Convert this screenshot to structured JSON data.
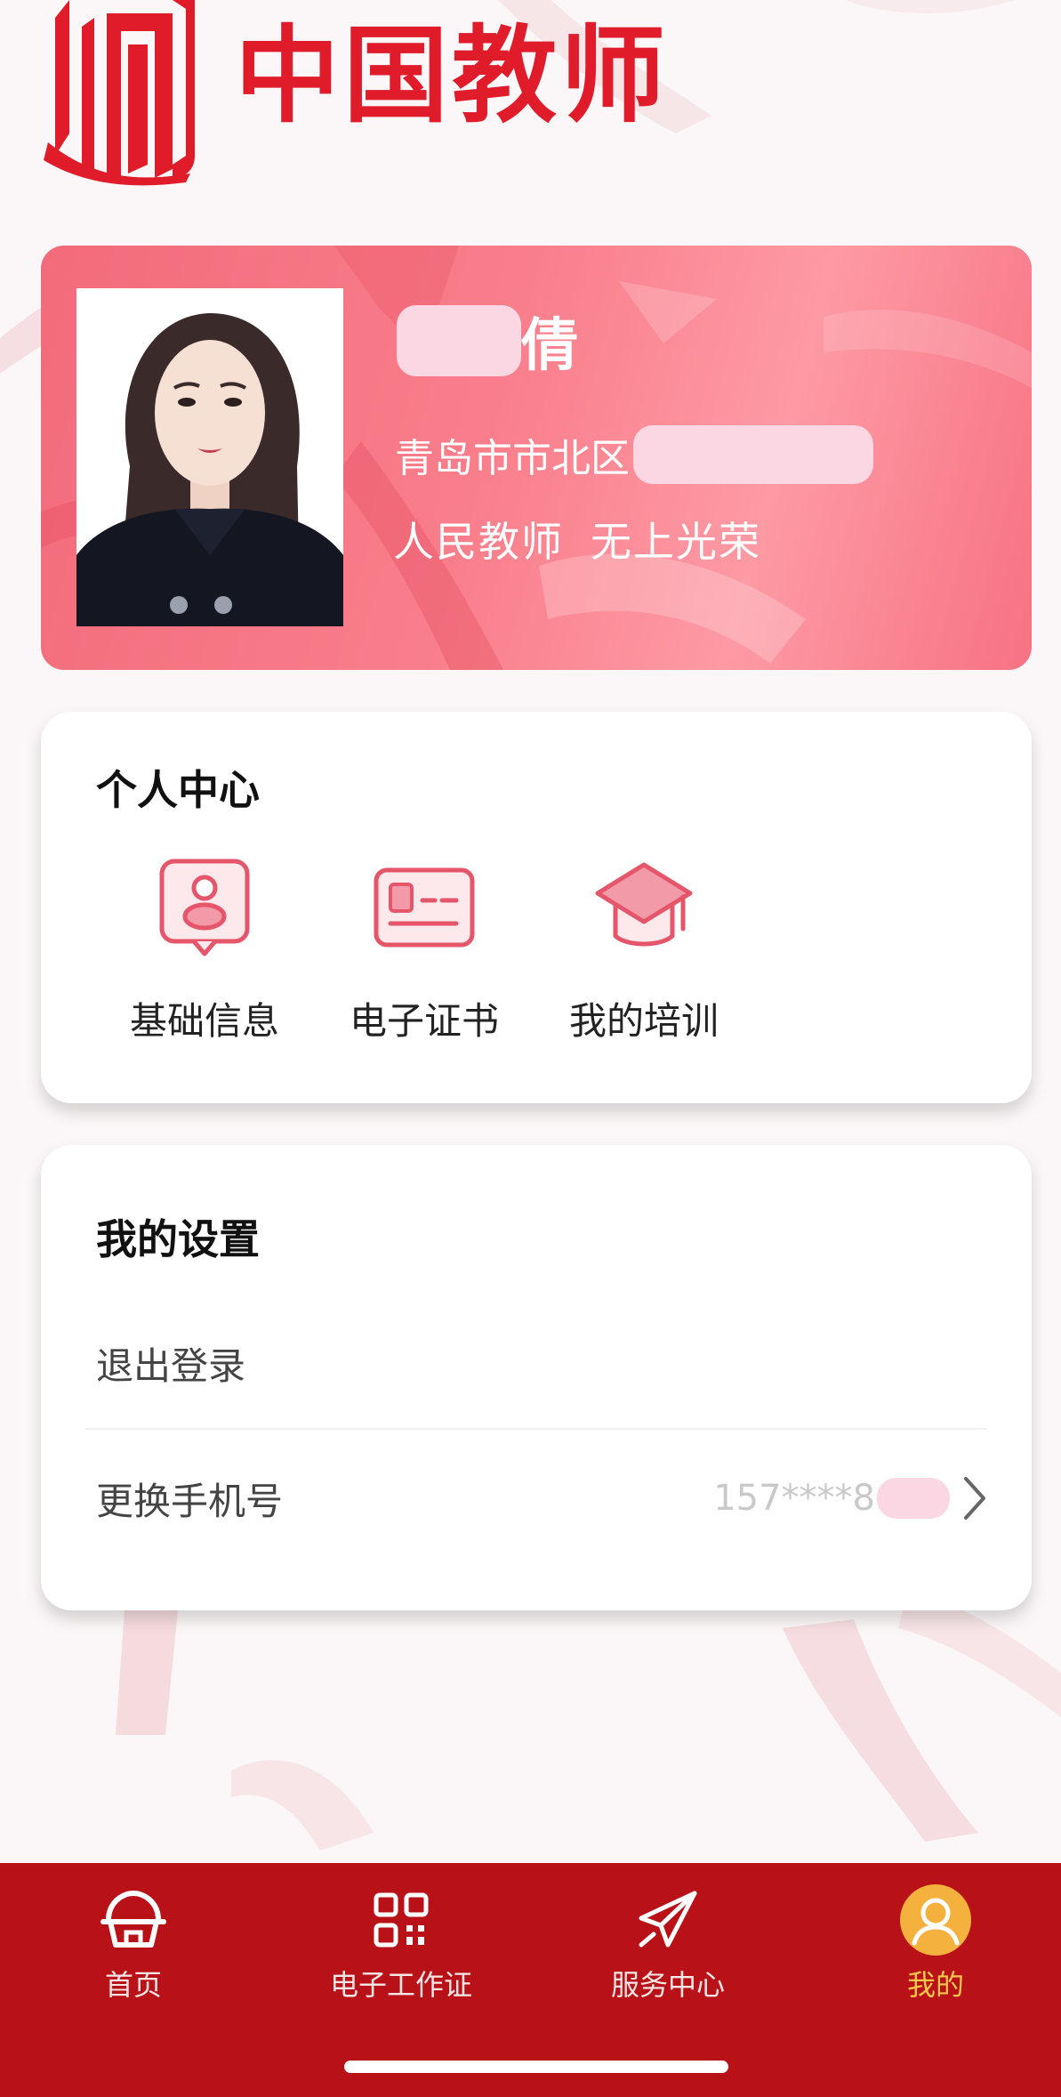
{
  "brand": {
    "logo_text": "中国教师",
    "accent_color": "#e01b2a"
  },
  "profile": {
    "name_visible": "倩",
    "region_prefix": "青岛市市北区",
    "slogan_part1": "人民教师",
    "slogan_part2": "无上光荣"
  },
  "personal_center": {
    "title": "个人中心",
    "items": [
      {
        "label": "基础信息",
        "icon": "profile-card-icon"
      },
      {
        "label": "电子证书",
        "icon": "id-card-icon"
      },
      {
        "label": "我的培训",
        "icon": "graduation-cap-icon"
      }
    ]
  },
  "settings": {
    "title": "我的设置",
    "logout_label": "退出登录",
    "change_phone_label": "更换手机号",
    "phone_value": "157****8",
    "chevron_icon": "chevron-right-icon"
  },
  "bottom_nav": {
    "items": [
      {
        "label": "首页",
        "icon": "home-icon",
        "active": false
      },
      {
        "label": "电子工作证",
        "icon": "qr-code-icon",
        "active": false
      },
      {
        "label": "服务中心",
        "icon": "paper-plane-icon",
        "active": false
      },
      {
        "label": "我的",
        "icon": "user-avatar-icon",
        "active": true
      }
    ],
    "background_color": "#b81218",
    "active_color": "#f7c64a"
  }
}
